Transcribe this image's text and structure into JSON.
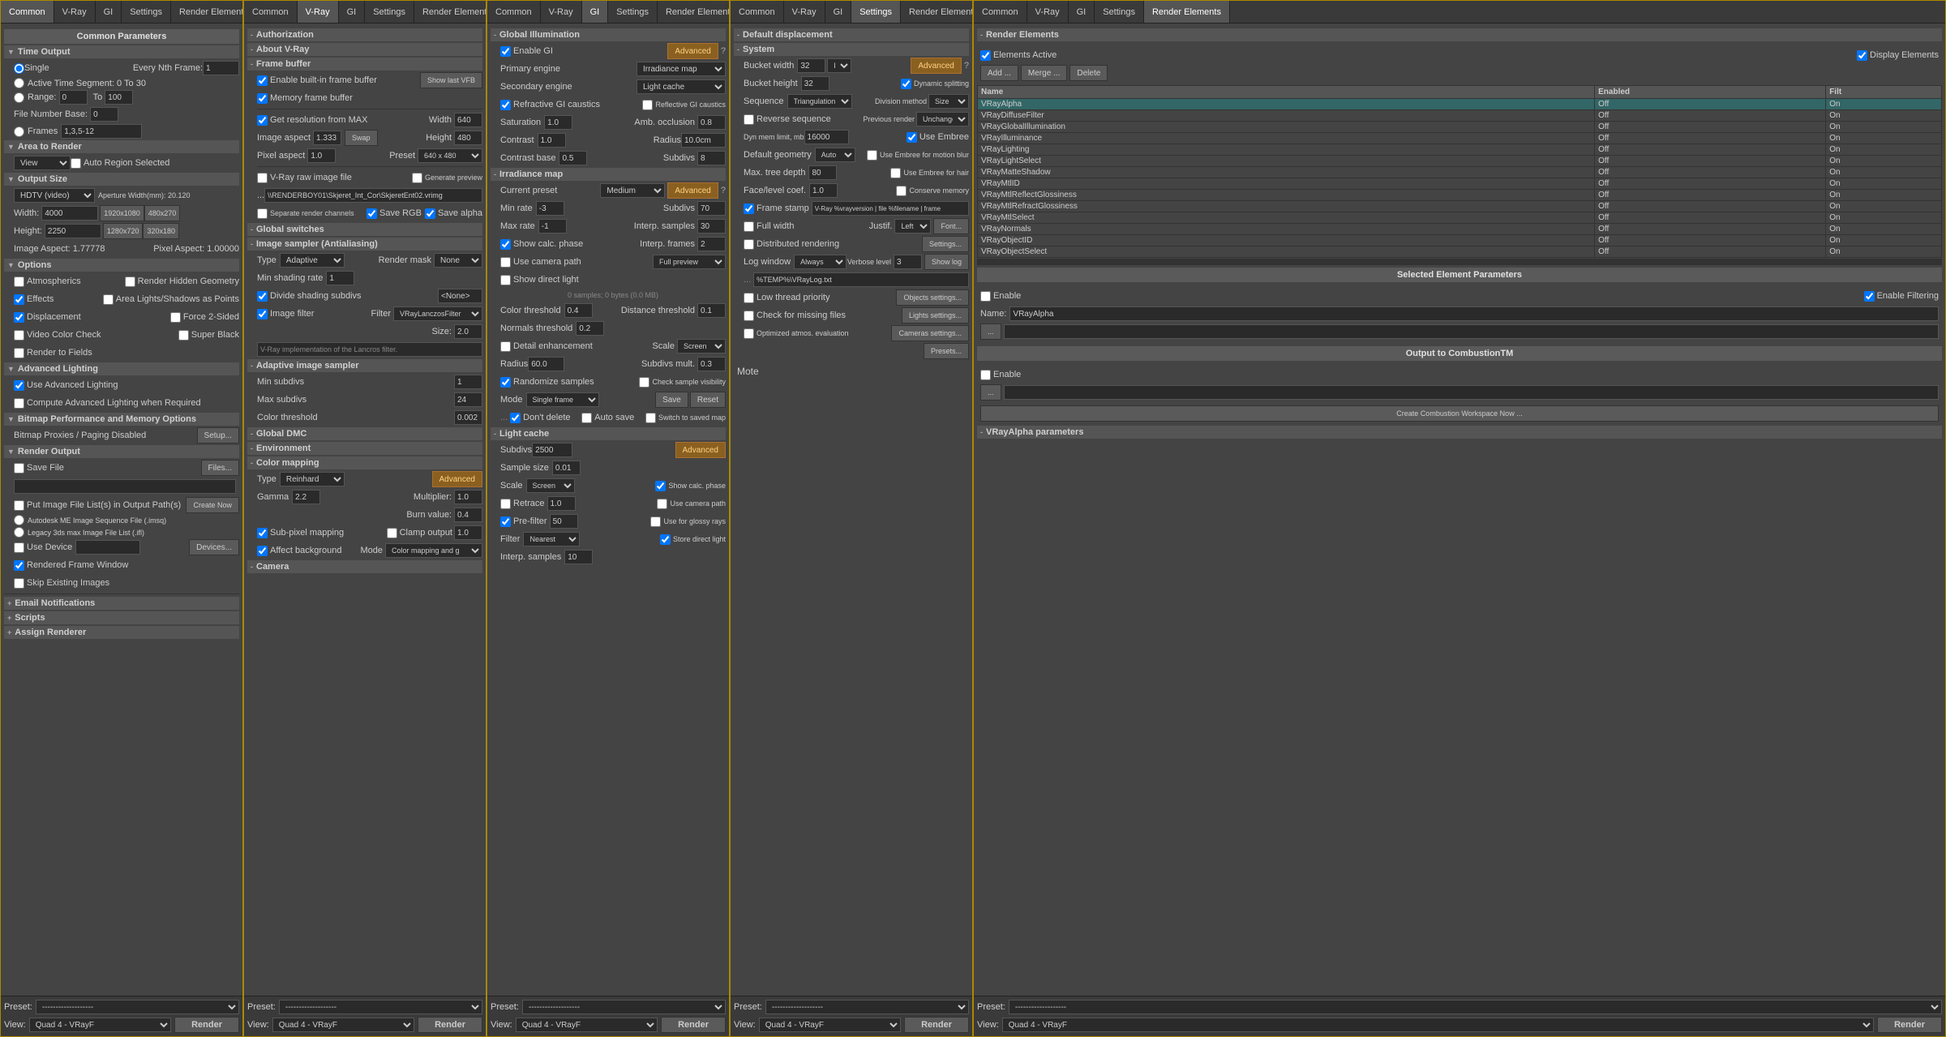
{
  "panels": [
    {
      "id": "common",
      "tabs": [
        "Common",
        "V-Ray",
        "GI",
        "Settings",
        "Render Elements"
      ],
      "active_tab": "Common",
      "title": "Common Parameters",
      "content": "common"
    },
    {
      "id": "vray",
      "tabs": [
        "Common",
        "V-Ray",
        "GI",
        "Settings",
        "Render Elements"
      ],
      "active_tab": "V-Ray",
      "content": "vray"
    },
    {
      "id": "gi",
      "tabs": [
        "Common",
        "V-Ray",
        "GI",
        "Settings",
        "Render Elements"
      ],
      "active_tab": "GI",
      "content": "gi"
    },
    {
      "id": "settings",
      "tabs": [
        "Common",
        "V-Ray",
        "GI",
        "Settings",
        "Render Elements"
      ],
      "active_tab": "Settings",
      "content": "settings"
    },
    {
      "id": "render_elements",
      "tabs": [
        "Common",
        "V-Ray",
        "GI",
        "Settings",
        "Render Elements"
      ],
      "active_tab": "Render Elements",
      "content": "render_elements"
    }
  ],
  "common": {
    "time_output": {
      "label": "Time Output",
      "single": "Single",
      "every_nth": "Every Nth Frame:",
      "nth_value": "1",
      "active_time": "Active Time Segment:",
      "active_range": "0 To 30",
      "range_label": "Range:",
      "range_from": "0",
      "range_to": "100",
      "file_number_base": "File Number Base:",
      "file_number_value": "0",
      "frames_label": "Frames",
      "frames_value": "1,3,5-12"
    },
    "area_to_render": {
      "label": "Area to Render",
      "view_label": "View",
      "auto_region": "Auto Region Selected"
    },
    "output_size": {
      "label": "Output Size",
      "preset": "HDTV (video)",
      "aperture": "Aperture Width(mm): 20.120",
      "width_label": "Width:",
      "width_value": "4000",
      "res1": "1920x1080",
      "res2": "480x270",
      "height_label": "Height:",
      "height_value": "2250",
      "res3": "1280x720",
      "res4": "320x180",
      "image_aspect": "Image Aspect: 1.77778",
      "pixel_aspect": "Pixel Aspect: 1.00000"
    },
    "options": {
      "label": "Options",
      "atmospherics": "Atmospherics",
      "render_hidden": "Render Hidden Geometry",
      "effects": "Effects",
      "area_lights": "Area Lights/Shadows as Points",
      "displacement": "Displacement",
      "force_2sided": "Force 2-Sided",
      "video_color_check": "Video Color Check",
      "super_black": "Super Black",
      "render_to_fields": "Render to Fields"
    },
    "advanced_lighting": {
      "label": "Advanced Lighting",
      "use_advanced": "Use Advanced Lighting",
      "compute_advanced": "Compute Advanced Lighting when Required"
    },
    "bitmap": {
      "label": "Bitmap Performance and Memory Options",
      "proxies": "Bitmap Proxies / Paging Disabled",
      "setup": "Setup..."
    },
    "render_output": {
      "label": "Render Output",
      "save_file": "Save File",
      "files_btn": "Files...",
      "put_image": "Put Image File List(s) in Output Path(s)",
      "create_now": "Create Now",
      "autodesk": "Autodesk ME Image Sequence File (.imsq)",
      "legacy": "Legacy 3ds max Image File List (.ifl)",
      "use_device": "Use Device",
      "devices_btn": "Devices...",
      "rendered_frame": "Rendered Frame Window",
      "skip_existing": "Skip Existing Images"
    },
    "email": "Email Notifications",
    "scripts": "Scripts",
    "assign_renderer": "Assign Renderer",
    "preset_label": "Preset:",
    "preset_value": "-------------------",
    "render_btn": "Render",
    "view_label": "View:",
    "view_value": "Quad 4 - VRayF"
  },
  "vray": {
    "authorization": "Authorization",
    "about": "About V-Ray",
    "frame_buffer": "Frame buffer",
    "enable_built_in": "Enable built-in frame buffer",
    "show_last_vfb": "Show last VFB",
    "memory_frame": "Memory frame buffer",
    "get_resolution": "Get resolution from MAX",
    "width_label": "Width",
    "width_value": "640",
    "swap_btn": "Swap",
    "image_aspect": "Image aspect",
    "image_aspect_val": "1.333",
    "height_label": "Height",
    "height_value": "480",
    "pixel_aspect": "Pixel aspect",
    "pixel_aspect_val": "1.0",
    "preset_label": "Preset",
    "preset_value": "640 x 480",
    "vray_raw": "V-Ray raw image file",
    "generate_preview": "Generate preview",
    "path_value": "\\\\RENDERBOY01\\Skjeret_Int_Cor\\SkjeretEnt02.vrimg",
    "separate_channels": "Separate render channels",
    "save_rgb": "Save RGB",
    "save_alpha": "Save alpha",
    "global_switches": "Global switches",
    "image_sampler": "Image sampler (Antialiasing)",
    "type_label": "Type",
    "type_value": "Adaptive",
    "render_mask": "Render mask",
    "render_mask_value": "None",
    "min_shading": "Min shading rate",
    "min_shading_val": "1",
    "divide_shading": "Divide shading subdivs",
    "filter_none": "<None>",
    "image_filter": "Image filter",
    "filter_label": "Filter",
    "filter_value": "VRayLanczosFilter",
    "size_label": "Size:",
    "size_value": "2.0",
    "lancros_desc": "V-Ray implementation of the Lancros filter.",
    "adaptive_sampler": "Adaptive image sampler",
    "min_subdivs": "Min subdivs",
    "min_subdivs_val": "1",
    "max_subdivs": "Max subdivs",
    "max_subdivs_val": "24",
    "color_threshold": "Color threshold",
    "color_threshold_val": "0.002",
    "global_dmc": "Global DMC",
    "environment": "Environment",
    "color_mapping": "Color mapping",
    "type_cm_label": "Type",
    "type_cm_value": "Reinhard",
    "advanced_btn": "Advanced",
    "gamma_label": "Gamma",
    "gamma_value": "2.2",
    "multiplier_label": "Multiplier:",
    "multiplier_value": "1.0",
    "burn_label": "Burn value:",
    "burn_value": "0.4",
    "sub_pixel": "Sub-pixel mapping",
    "clamp_output": "Clamp output",
    "clamp_value": "1.0",
    "affect_bg": "Affect background",
    "mode_label": "Mode",
    "mode_value": "Color mapping and g",
    "camera_label": "Camera",
    "preset_label2": "Preset:",
    "preset_value2": "-------------------",
    "render_btn": "Render",
    "view_label": "View:",
    "view_value": "Quad 4 - VRayF"
  },
  "gi": {
    "title": "Global Illumination",
    "enable_gi": "Enable GI",
    "advanced_btn": "Advanced",
    "primary_engine": "Primary engine",
    "primary_value": "Irradiance map",
    "secondary_engine": "Secondary engine",
    "secondary_value": "Light cache",
    "refractive_gi": "Refractive GI caustics",
    "reflective_gi": "Reflective GI caustics",
    "saturation": "Saturation",
    "sat_value": "1.0",
    "amb_occlusion": "Amb. occlusion",
    "amb_value": "0.8",
    "contrast": "Contrast",
    "contrast_value": "1.0",
    "radius_label": "Radius",
    "radius_value": "10.0cm",
    "contrast_base": "Contrast base",
    "cb_value": "0.5",
    "subdivs_label": "Subdivs",
    "subdivs_value": "8",
    "irradiance_map": "Irradiance map",
    "current_preset": "Current preset",
    "preset_value": "Medium",
    "advanced_btn2": "Advanced",
    "min_rate": "Min rate",
    "min_rate_val": "-3",
    "subdiv_label": "Subdivs",
    "subdiv_val": "70",
    "max_rate": "Max rate",
    "max_rate_val": "-1",
    "interp_samples": "Interp. samples",
    "interp_samples_val": "30",
    "show_calc_phase": "Show calc. phase",
    "use_camera_path": "Use camera path",
    "interp_frames": "Interp. frames",
    "interp_frames_val": "2",
    "full_preview": "Full preview",
    "show_direct_light": "Show direct light",
    "bytes_info": "0 samples; 0 bytes (0.0 MB)",
    "color_threshold": "Color threshold",
    "ct_val": "0.4",
    "distance_threshold": "Distance threshold",
    "dt_val": "0.1",
    "normals_threshold": "Normals threshold",
    "nt_val": "0.2",
    "detail_enhancement": "Detail enhancement",
    "scale_label": "Scale",
    "scale_value": "Screen",
    "radius_label2": "Radius",
    "radius_val2": "60.0",
    "subdivs_mult": "Subdivs mult.",
    "subdivs_mult_val": "0.3",
    "randomize_samples": "Randomize samples",
    "check_sample_vis": "Check sample visibility",
    "mode_label": "Mode",
    "mode_value": "Single frame",
    "save_btn": "Save",
    "reset_btn": "Reset",
    "dont_delete": "Don't delete",
    "auto_save": "Auto save",
    "switch_saved": "Switch to saved map",
    "light_cache": "Light cache",
    "lc_subdivs": "Subdivs",
    "lc_subdivs_val": "2500",
    "lc_advanced": "Advanced",
    "sample_size": "Sample size",
    "sample_size_val": "0.01",
    "scale_lc": "Scale",
    "scale_lc_val": "Screen",
    "show_calc_phase_lc": "Show calc. phase",
    "retrace": "Retrace",
    "retrace_val": "1.0",
    "use_camera_path_lc": "Use camera path",
    "pre_filter": "Pre-filter",
    "pre_filter_val": "50",
    "use_glossy": "Use for glossy rays",
    "filter_label": "Filter",
    "filter_value": "Nearest",
    "store_direct": "Store direct light",
    "interp_samples_lc": "Interp. samples",
    "interp_samples_lc_val": "10",
    "preset_label": "Preset:",
    "preset_value2": "-------------------",
    "render_btn": "Render",
    "view_label": "View:",
    "view_value": "Quad 4 - VRayF"
  },
  "settings": {
    "title": "Default displacement",
    "system_label": "System",
    "bucket_width": "Bucket width",
    "bucket_width_val": "32",
    "bucket_width_unit": "L",
    "advanced_btn": "Advanced",
    "bucket_height": "Bucket height",
    "bucket_height_val": "32",
    "dynamic_splitting": "Dynamic splitting",
    "sequence": "Sequence",
    "sequence_val": "Triangulation",
    "division_method": "Division method",
    "division_val": "Size",
    "reverse_sequence": "Reverse sequence",
    "prev_render": "Previous render",
    "prev_render_val": "Unchange",
    "dyn_mem_limit": "Dyn mem limit, mb",
    "dyn_mem_val": "16000",
    "use_embree": "Use Embree",
    "default_geometry": "Default geometry",
    "def_geo_val": "Auto",
    "embree_motion": "Use Embree for motion blur",
    "max_tree_depth": "Max. tree depth",
    "max_tree_val": "80",
    "embree_hair": "Use Embree for hair",
    "face_level": "Face/level coef.",
    "face_level_val": "1.0",
    "conserve_memory": "Conserve memory",
    "frame_stamp": "Frame stamp",
    "frame_stamp_val": "V-Ray %vrayversion | file %filename | frame",
    "full_width": "Full width",
    "justify_label": "Justif.",
    "justify_val": "Left",
    "font_btn": "Font...",
    "distributed": "Distributed rendering",
    "settings_btn": "Settings...",
    "log_window": "Log window",
    "log_val": "Always",
    "verbose_level": "Verbose level",
    "verbose_val": "3",
    "show_log": "Show log",
    "log_path": "%TEMP%\\VRayLog.txt",
    "low_thread": "Low thread priority",
    "objects_settings": "Objects settings...",
    "check_missing": "Check for missing files",
    "lights_settings": "Lights settings...",
    "optimized_atmos": "Optimized atmos. evaluation",
    "cameras_settings": "Cameras settings...",
    "presets_btn": "Presets...",
    "preset_label": "Preset:",
    "preset_value": "-------------------",
    "render_btn": "Render",
    "view_label": "View:",
    "view_value": "Quad 4 - VRayF",
    "mote_label": "Mote"
  },
  "render_elements": {
    "title": "Render Elements",
    "elements_active": "Elements Active",
    "display_elements": "Display Elements",
    "add_btn": "Add ...",
    "merge_btn": "Merge ...",
    "delete_btn": "Delete",
    "table_headers": [
      "Name",
      "Enabled",
      "Filt"
    ],
    "elements": [
      {
        "name": "VRayAlpha",
        "enabled": "Off",
        "filter": "On"
      },
      {
        "name": "VRayDiffuseFilter",
        "enabled": "Off",
        "filter": "On"
      },
      {
        "name": "VRayGlobalIllumination",
        "enabled": "Off",
        "filter": "On"
      },
      {
        "name": "VRayIlluminance",
        "enabled": "Off",
        "filter": "On"
      },
      {
        "name": "VRayLighting",
        "enabled": "Off",
        "filter": "On"
      },
      {
        "name": "VRayLightSelect",
        "enabled": "Off",
        "filter": "On"
      },
      {
        "name": "VRayMatteShadow",
        "enabled": "Off",
        "filter": "On"
      },
      {
        "name": "VRayMtlID",
        "enabled": "Off",
        "filter": "On"
      },
      {
        "name": "VRayMtlReflectGlossiness",
        "enabled": "Off",
        "filter": "On"
      },
      {
        "name": "VRayMtlRefractGlossiness",
        "enabled": "Off",
        "filter": "On"
      },
      {
        "name": "VRayMtlSelect",
        "enabled": "Off",
        "filter": "On"
      },
      {
        "name": "VRayNormals",
        "enabled": "Off",
        "filter": "On"
      },
      {
        "name": "VRayObjectID",
        "enabled": "Off",
        "filter": "On"
      },
      {
        "name": "VRayObjectSelect",
        "enabled": "Off",
        "filter": "On"
      }
    ],
    "selected_element_params": "Selected Element Parameters",
    "enable_label": "Enable",
    "enable_filtering": "Enable Filtering",
    "name_label": "Name:",
    "name_value": "VRayAlpha",
    "dots_btn": "...",
    "output_combustion": "Output to CombustionTM",
    "enable_combustion": "Enable",
    "dots_btn2": "...",
    "create_combustion": "Create Combustion Workspace Now ...",
    "vrayalpha_params": "VRayAlpha parameters",
    "preset_label": "Preset:",
    "preset_value": "-------------------",
    "render_btn": "Render",
    "view_label": "View:",
    "view_value": "Quad 4 - VRayF"
  }
}
